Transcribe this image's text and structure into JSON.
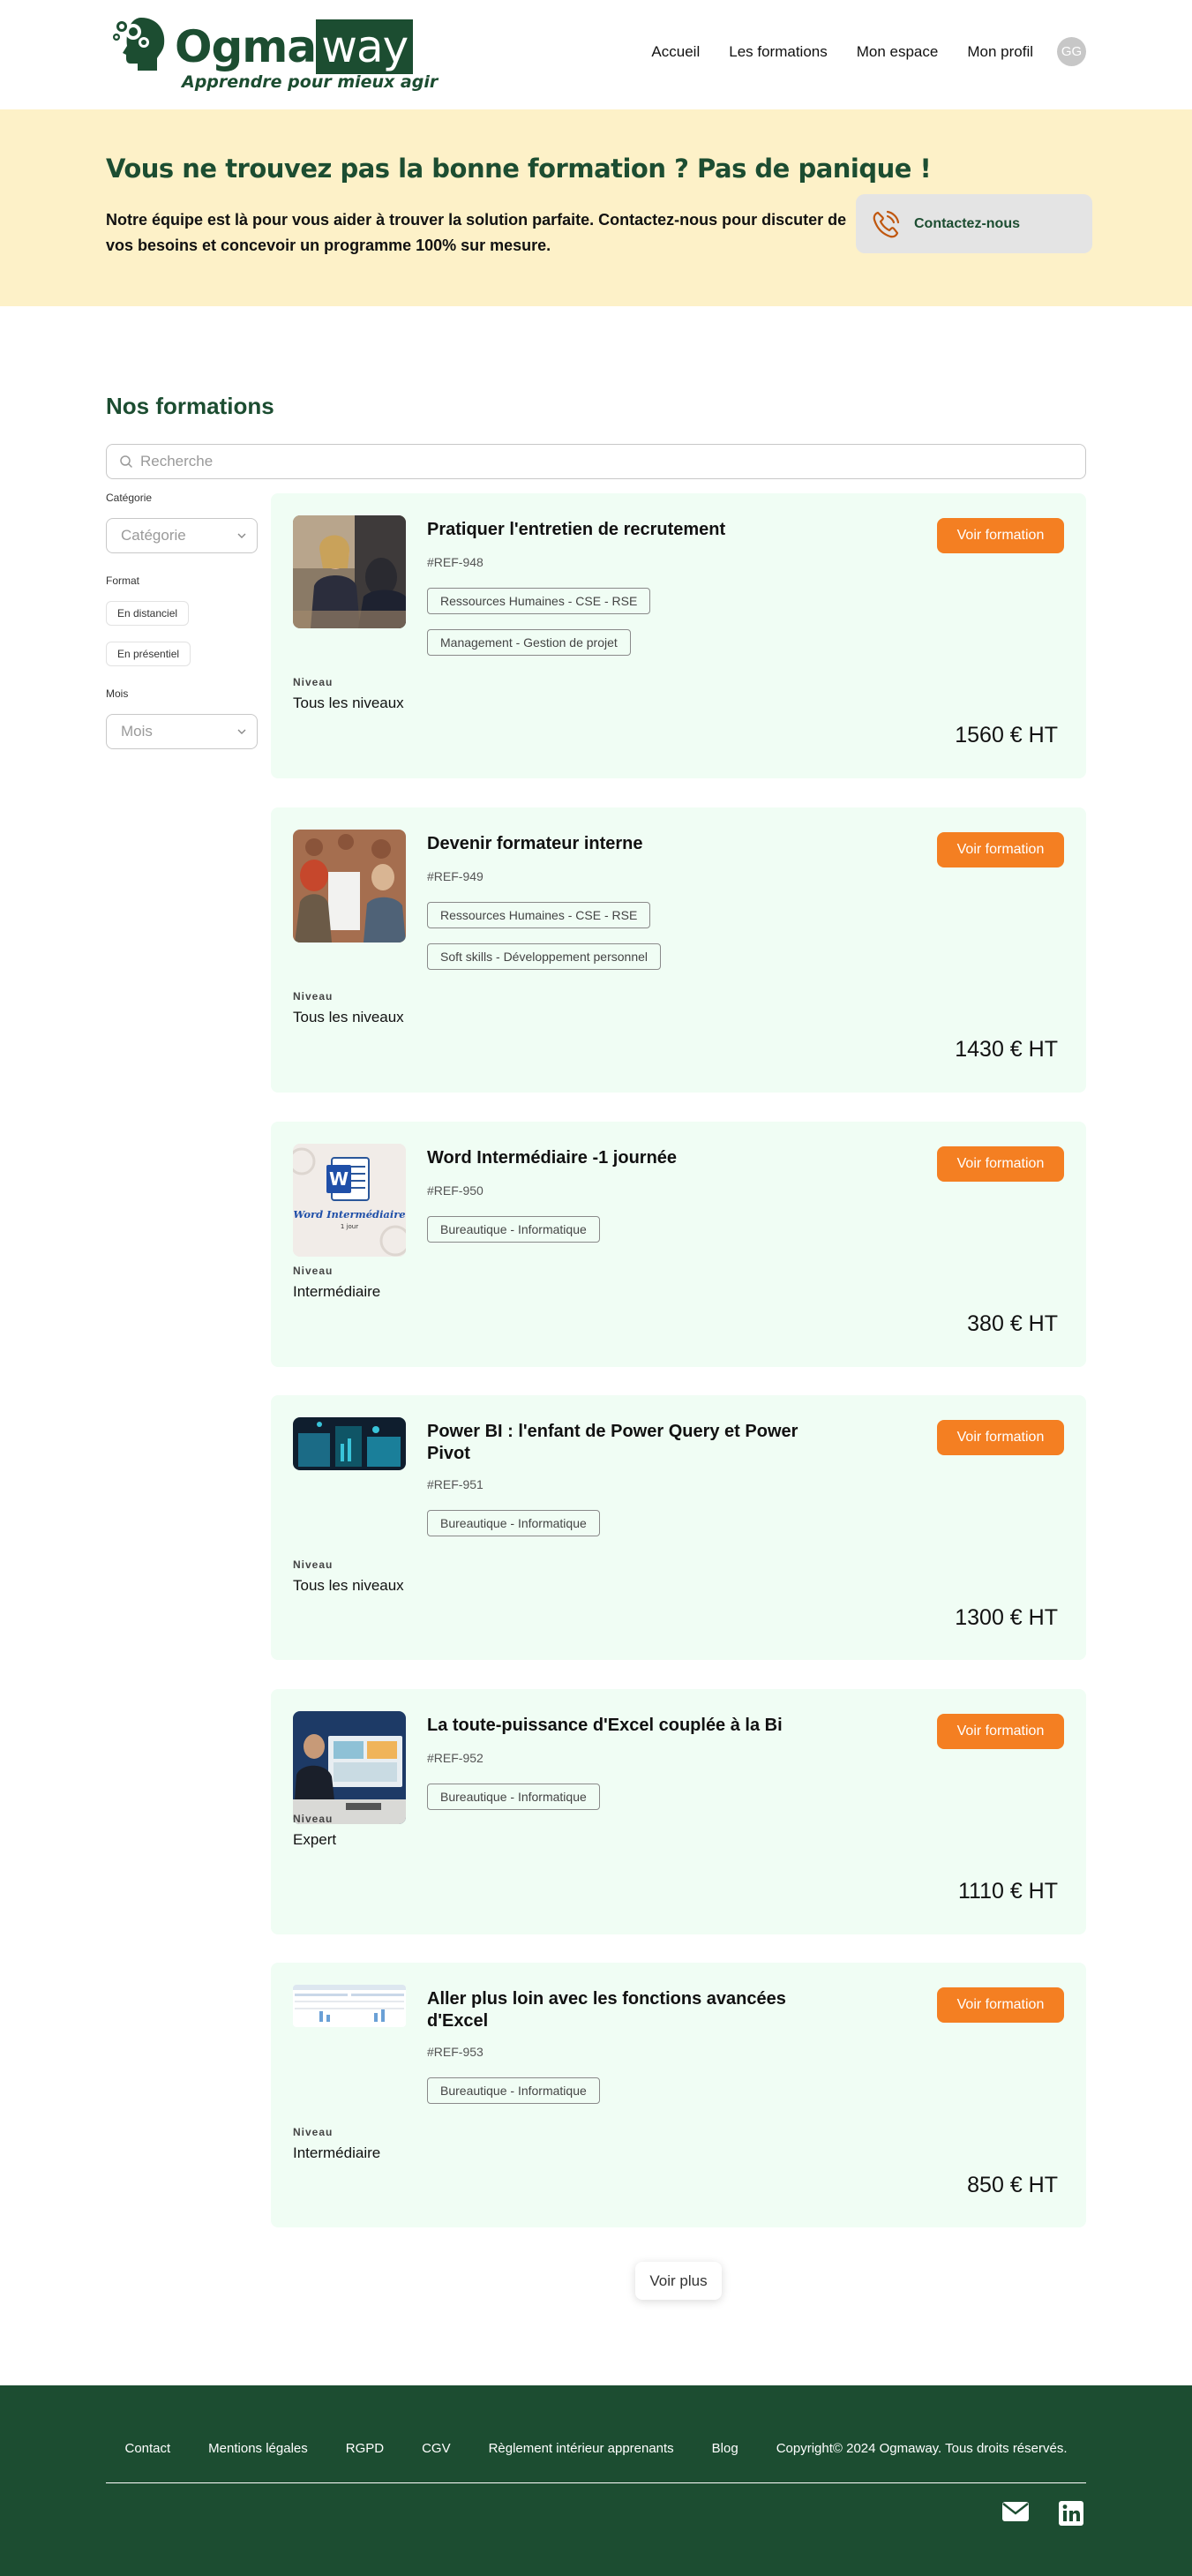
{
  "header": {
    "logo": {
      "brand_part1": "Ogma",
      "brand_part2": "way",
      "tagline": "Apprendre pour mieux agir"
    },
    "nav": [
      "Accueil",
      "Les formations",
      "Mon espace",
      "Mon profil"
    ],
    "avatar_initials": "GG"
  },
  "banner": {
    "title": "Vous ne trouvez pas la bonne formation ? Pas de panique !",
    "text": "Notre équipe est là pour vous aider à trouver la solution parfaite. Contactez-nous pour discuter de vos besoins et concevoir un programme 100% sur mesure.",
    "contact_label": "Contactez-nous"
  },
  "main": {
    "title": "Nos formations",
    "search_placeholder": "Recherche",
    "filters": {
      "category_label": "Catégorie",
      "category_placeholder": "Catégorie",
      "format_label": "Format",
      "format_options": [
        "En distanciel",
        "En présentiel"
      ],
      "month_label": "Mois",
      "month_placeholder": "Mois"
    },
    "level_label": "Niveau",
    "button_label": "Voir formation",
    "courses": [
      {
        "title": "Pratiquer l'entretien de recrutement",
        "ref": "#REF-948",
        "tags": [
          "Ressources Humaines - CSE - RSE",
          "Management - Gestion de projet"
        ],
        "level": "Tous les niveaux",
        "price": "1560 € HT",
        "image": "interview-photo"
      },
      {
        "title": "Devenir formateur interne",
        "ref": "#REF-949",
        "tags": [
          "Ressources Humaines - CSE - RSE",
          "Soft skills - Développement personnel"
        ],
        "level": "Tous les niveaux",
        "price": "1430 € HT",
        "image": "trainer-photo"
      },
      {
        "title": "Word Intermédiaire -1 journée",
        "ref": "#REF-950",
        "tags": [
          "Bureautique - Informatique"
        ],
        "level": "Intermédiaire",
        "price": "380 € HT",
        "image": "word-cover",
        "image_caption": "Word Intermédiaire",
        "image_subcaption": "1 jour"
      },
      {
        "title": "Power BI : l'enfant de Power Query et Power Pivot",
        "ref": "#REF-951",
        "tags": [
          "Bureautique - Informatique"
        ],
        "level": "Tous les niveaux",
        "price": "1300 € HT",
        "image": "powerbi-photo"
      },
      {
        "title": "La toute-puissance d'Excel couplée à la Bi",
        "ref": "#REF-952",
        "tags": [
          "Bureautique - Informatique"
        ],
        "level": "Expert",
        "price": "1110 € HT",
        "image": "excel-bi-photo"
      },
      {
        "title": "Aller plus loin avec les fonctions avancées d'Excel",
        "ref": "#REF-953",
        "tags": [
          "Bureautique - Informatique"
        ],
        "level": "Intermédiaire",
        "price": "850 € HT",
        "image": "excel-advanced-screenshot"
      }
    ],
    "load_more_label": "Voir plus"
  },
  "footer": {
    "links": [
      "Contact",
      "Mentions légales",
      "RGPD",
      "CGV",
      "Règlement intérieur apprenants",
      "Blog"
    ],
    "copyright": "Copyright© 2024 Ogmaway. Tous droits réservés.",
    "icons": [
      "mail-icon",
      "linkedin-icon"
    ]
  },
  "colors": {
    "brand_green": "#1c4d31",
    "accent_orange": "#f47f22",
    "banner_bg": "#fdf1c8",
    "card_bg": "#f0fdf4"
  }
}
